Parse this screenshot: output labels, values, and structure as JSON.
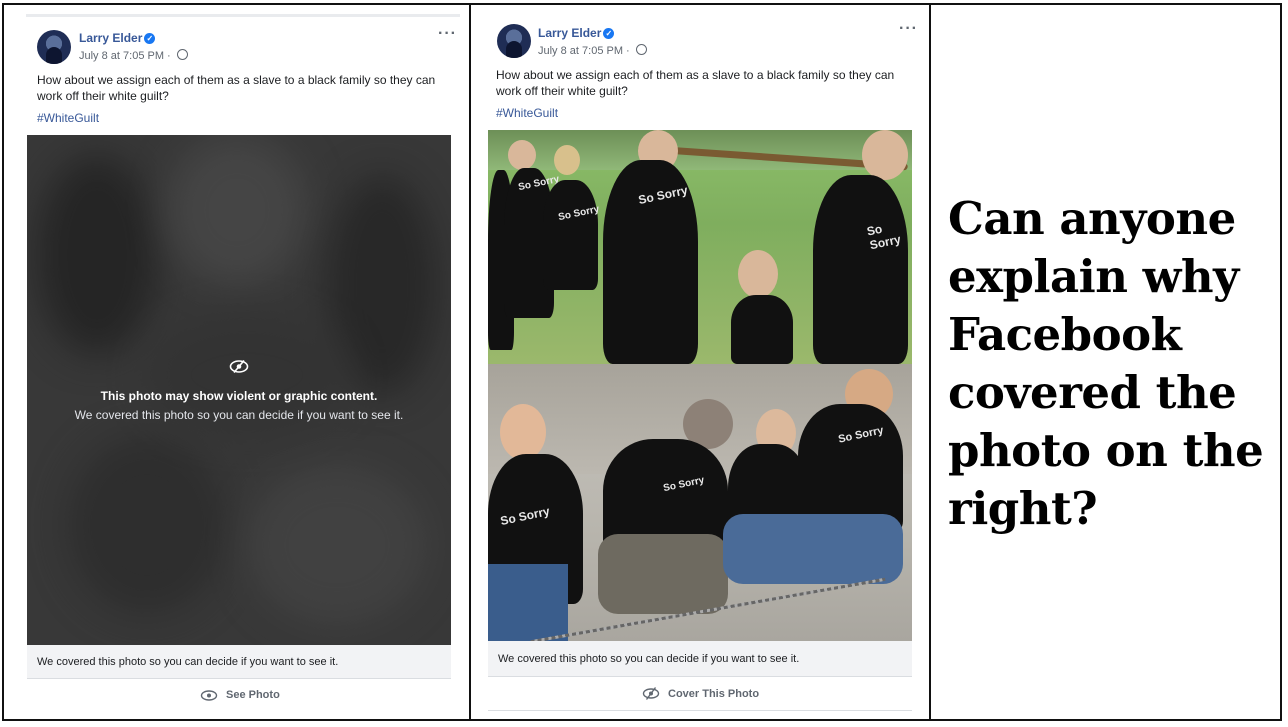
{
  "left_post": {
    "author": "Larry Elder",
    "date": "July 8 at 7:05 PM · ",
    "text": "How about we assign each of them as a slave to a black family so they can work off their white guilt?",
    "hashtag": "#WhiteGuilt",
    "warning_title": "This photo may show violent or graphic content.",
    "warning_sub": "We covered this photo so you can decide if you want to see it.",
    "caption": "We covered this photo so you can decide if you want to see it.",
    "action_label": "See Photo"
  },
  "right_post": {
    "author": "Larry Elder",
    "date": "July 8 at 7:05 PM · ",
    "text": "How about we assign each of them as a slave to a black family so they can work off their white guilt?",
    "hashtag": "#WhiteGuilt",
    "shirt_labels": [
      "So Sorry",
      "So Sorry",
      "So Sorry",
      "So Sorry",
      "So Sorry",
      "So Sorry",
      "So Sorry"
    ],
    "caption": "We covered this photo so you can decide if you want to see it.",
    "action_label": "Cover This Photo"
  },
  "question": "Can anyone explain why Facebook covered the photo on the right?",
  "colors": {
    "link": "#385898",
    "verified": "#1877f2",
    "muted": "#606770"
  },
  "icons": [
    "verified-badge-icon",
    "globe-icon",
    "more-options-icon",
    "eye-crossed-icon",
    "eye-icon"
  ]
}
